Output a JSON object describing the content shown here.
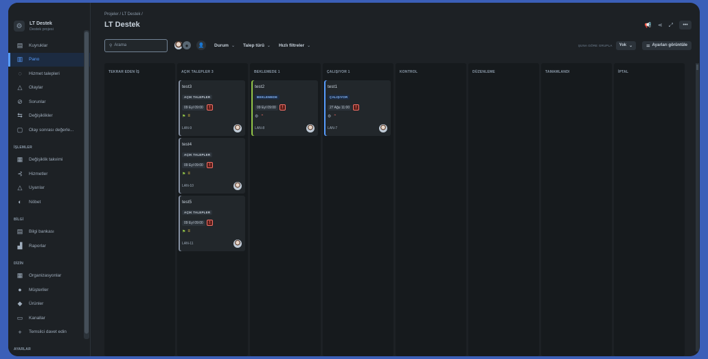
{
  "project": {
    "name": "LT Destek",
    "subtitle": "Destek projesi",
    "logo_icon": "project-logo-icon"
  },
  "sidebar": {
    "items": [
      {
        "label": "Kuyruklar",
        "icon": "queue-icon",
        "active": false
      },
      {
        "label": "Pano",
        "icon": "board-icon",
        "active": true
      },
      {
        "label": "Hizmet talepleri",
        "icon": "request-icon",
        "active": false
      },
      {
        "label": "Olaylar",
        "icon": "incident-icon",
        "active": false
      },
      {
        "label": "Sorunlar",
        "icon": "problem-icon",
        "active": false
      },
      {
        "label": "Değişiklikler",
        "icon": "change-icon",
        "active": false
      },
      {
        "label": "Olay sonrası değerle...",
        "icon": "review-icon",
        "active": false
      }
    ],
    "sections": [
      {
        "label": "İŞLEMLER",
        "items": [
          {
            "label": "Değişiklik takvimi",
            "icon": "calendar-icon"
          },
          {
            "label": "Hizmetler",
            "icon": "services-icon"
          },
          {
            "label": "Uyarılar",
            "icon": "alert-icon"
          },
          {
            "label": "Nöbet",
            "icon": "on-call-icon"
          }
        ]
      },
      {
        "label": "BİLGİ",
        "items": [
          {
            "label": "Bilgi bankası",
            "icon": "knowledge-icon"
          },
          {
            "label": "Raporlar",
            "icon": "reports-icon"
          }
        ]
      },
      {
        "label": "DİZİN",
        "items": [
          {
            "label": "Organizasyonlar",
            "icon": "organization-icon"
          },
          {
            "label": "Müşteriler",
            "icon": "customers-icon"
          },
          {
            "label": "Ürünler",
            "icon": "products-icon"
          },
          {
            "label": "Kanallar",
            "icon": "channels-icon"
          },
          {
            "label": "Temsilci davet edin",
            "icon": "invite-icon"
          }
        ]
      },
      {
        "label": "AYARLAR",
        "items": []
      }
    ]
  },
  "header": {
    "breadcrumb": "Projeler  /  LT Destek  /",
    "title": "LT Destek"
  },
  "toolbar": {
    "search_placeholder": "Arama",
    "filters": [
      "Durum",
      "Talep türü",
      "Hızlı filtreler"
    ],
    "group_by_label": "ŞUNA GÖRE GRUPLA",
    "group_by_value": "Yok",
    "settings_label": "Ayarları görüntüle"
  },
  "board": {
    "columns": [
      {
        "title": "TEKRAR EDEN İŞ",
        "cards": []
      },
      {
        "title": "AÇIK TALEPLER 3",
        "cards": [
          {
            "title": "test3",
            "status": "AÇIK TALEPLER",
            "status_type": "open",
            "date": "09 Eyl 09:00",
            "key": "LAN-9"
          },
          {
            "title": "test4",
            "status": "AÇIK TALEPLER",
            "status_type": "open",
            "date": "09 Eyl 09:00",
            "key": "LAN-10"
          },
          {
            "title": "test5",
            "status": "AÇIK TALEPLER",
            "status_type": "open",
            "date": "09 Eyl 09:00",
            "key": "LAN-11"
          }
        ]
      },
      {
        "title": "BEKLEMEDE 1",
        "cards": [
          {
            "title": "test2",
            "status": "BEKLEMEDE",
            "status_type": "wait",
            "date": "09 Eyl 09:00",
            "key": "LAN-8"
          }
        ]
      },
      {
        "title": "ÇALIŞIYOR 1",
        "cards": [
          {
            "title": "test1",
            "status": "ÇALIŞIYOR",
            "status_type": "work",
            "date": "27 Ağu 11:00",
            "key": "LAN-7"
          }
        ]
      },
      {
        "title": "KONTROL",
        "cards": []
      },
      {
        "title": "DÜZENLEME",
        "cards": []
      },
      {
        "title": "TAMAMLANDI",
        "cards": []
      },
      {
        "title": "İPTAL",
        "cards": []
      }
    ]
  },
  "colors": {
    "accent": "#579dff",
    "background": "#1d2125",
    "card": "#22272b",
    "danger": "#f87168"
  }
}
